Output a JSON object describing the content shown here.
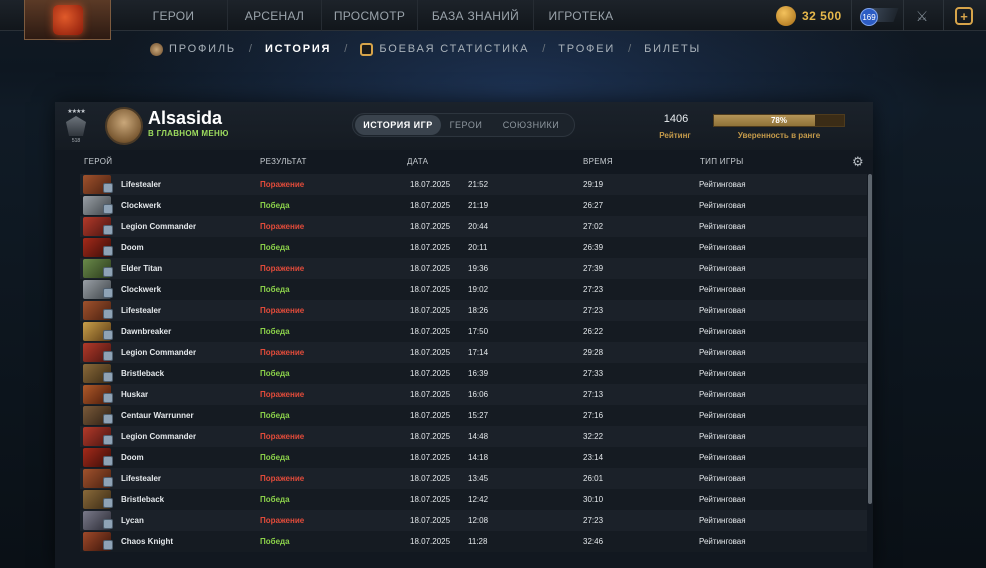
{
  "topnav": {
    "items": [
      "ГЕРОИ",
      "АРСЕНАЛ",
      "ПРОСМОТР",
      "БАЗА ЗНАНИЙ",
      "ИГРОТЕКА"
    ],
    "currency": "32 500",
    "level": "169"
  },
  "subnav": {
    "items": [
      {
        "label": "ПРОФИЛЬ",
        "active": false
      },
      {
        "label": "ИСТОРИЯ",
        "active": true
      },
      {
        "label": "БОЕВАЯ СТАТИСТИКА",
        "active": false
      },
      {
        "label": "ТРОФЕИ",
        "active": false
      },
      {
        "label": "БИЛЕТЫ",
        "active": false
      }
    ]
  },
  "player": {
    "name": "Alsasida",
    "status": "В ГЛАВНОМ МЕНЮ",
    "rank_number": "518"
  },
  "tabs": [
    {
      "label": "ИСТОРИЯ ИГР",
      "active": true
    },
    {
      "label": "ГЕРОИ",
      "active": false
    },
    {
      "label": "СОЮЗНИКИ",
      "active": false
    }
  ],
  "rating": {
    "value": "1406",
    "label": "Рейтинг",
    "confidence_text": "78%",
    "confidence_fraction": 0.78,
    "confidence_label": "Уверенность в ранге"
  },
  "table": {
    "headers": {
      "hero": "ГЕРОЙ",
      "result": "РЕЗУЛЬТАТ",
      "date": "ДАТА",
      "duration": "ВРЕМЯ",
      "mode": "ТИП ИГРЫ"
    },
    "rows": [
      {
        "hero": "Lifestealer",
        "result": "Поражение",
        "win": false,
        "date": "18.07.2025",
        "time": "21:52",
        "duration": "29:19",
        "mode": "Рейтинговая"
      },
      {
        "hero": "Clockwerk",
        "result": "Победа",
        "win": true,
        "date": "18.07.2025",
        "time": "21:19",
        "duration": "26:27",
        "mode": "Рейтинговая"
      },
      {
        "hero": "Legion Commander",
        "result": "Поражение",
        "win": false,
        "date": "18.07.2025",
        "time": "20:44",
        "duration": "27:02",
        "mode": "Рейтинговая"
      },
      {
        "hero": "Doom",
        "result": "Победа",
        "win": true,
        "date": "18.07.2025",
        "time": "20:11",
        "duration": "26:39",
        "mode": "Рейтинговая"
      },
      {
        "hero": "Elder Titan",
        "result": "Поражение",
        "win": false,
        "date": "18.07.2025",
        "time": "19:36",
        "duration": "27:39",
        "mode": "Рейтинговая"
      },
      {
        "hero": "Clockwerk",
        "result": "Победа",
        "win": true,
        "date": "18.07.2025",
        "time": "19:02",
        "duration": "27:23",
        "mode": "Рейтинговая"
      },
      {
        "hero": "Lifestealer",
        "result": "Поражение",
        "win": false,
        "date": "18.07.2025",
        "time": "18:26",
        "duration": "27:23",
        "mode": "Рейтинговая"
      },
      {
        "hero": "Dawnbreaker",
        "result": "Победа",
        "win": true,
        "date": "18.07.2025",
        "time": "17:50",
        "duration": "26:22",
        "mode": "Рейтинговая"
      },
      {
        "hero": "Legion Commander",
        "result": "Поражение",
        "win": false,
        "date": "18.07.2025",
        "time": "17:14",
        "duration": "29:28",
        "mode": "Рейтинговая"
      },
      {
        "hero": "Bristleback",
        "result": "Победа",
        "win": true,
        "date": "18.07.2025",
        "time": "16:39",
        "duration": "27:33",
        "mode": "Рейтинговая"
      },
      {
        "hero": "Huskar",
        "result": "Поражение",
        "win": false,
        "date": "18.07.2025",
        "time": "16:06",
        "duration": "27:13",
        "mode": "Рейтинговая"
      },
      {
        "hero": "Centaur Warrunner",
        "result": "Победа",
        "win": true,
        "date": "18.07.2025",
        "time": "15:27",
        "duration": "27:16",
        "mode": "Рейтинговая"
      },
      {
        "hero": "Legion Commander",
        "result": "Поражение",
        "win": false,
        "date": "18.07.2025",
        "time": "14:48",
        "duration": "32:22",
        "mode": "Рейтинговая"
      },
      {
        "hero": "Doom",
        "result": "Победа",
        "win": true,
        "date": "18.07.2025",
        "time": "14:18",
        "duration": "23:14",
        "mode": "Рейтинговая"
      },
      {
        "hero": "Lifestealer",
        "result": "Поражение",
        "win": false,
        "date": "18.07.2025",
        "time": "13:45",
        "duration": "26:01",
        "mode": "Рейтинговая"
      },
      {
        "hero": "Bristleback",
        "result": "Победа",
        "win": true,
        "date": "18.07.2025",
        "time": "12:42",
        "duration": "30:10",
        "mode": "Рейтинговая"
      },
      {
        "hero": "Lycan",
        "result": "Поражение",
        "win": false,
        "date": "18.07.2025",
        "time": "12:08",
        "duration": "27:23",
        "mode": "Рейтинговая"
      },
      {
        "hero": "Chaos Knight",
        "result": "Победа",
        "win": true,
        "date": "18.07.2025",
        "time": "11:28",
        "duration": "32:46",
        "mode": "Рейтинговая"
      }
    ]
  },
  "colors": {
    "win": "#8bd14a",
    "loss": "#e14b3a",
    "accent_gold": "#c49a4a"
  }
}
